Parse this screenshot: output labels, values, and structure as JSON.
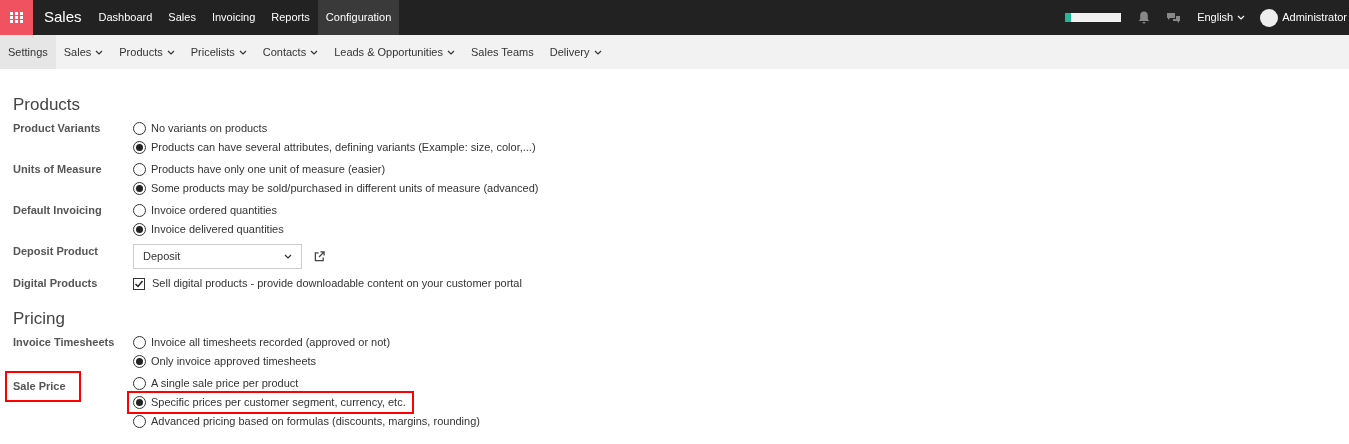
{
  "topbar": {
    "app": "Sales",
    "menu": [
      {
        "label": "Dashboard",
        "selected": false
      },
      {
        "label": "Sales",
        "selected": false
      },
      {
        "label": "Invoicing",
        "selected": false
      },
      {
        "label": "Reports",
        "selected": false
      },
      {
        "label": "Configuration",
        "selected": true
      }
    ],
    "progress": {
      "level": 0.1
    },
    "language": "English",
    "user": "Administrator"
  },
  "submenu": [
    {
      "label": "Settings",
      "selected": true,
      "dropdown": false
    },
    {
      "label": "Sales",
      "selected": false,
      "dropdown": true
    },
    {
      "label": "Products",
      "selected": false,
      "dropdown": true
    },
    {
      "label": "Pricelists",
      "selected": false,
      "dropdown": true
    },
    {
      "label": "Contacts",
      "selected": false,
      "dropdown": true
    },
    {
      "label": "Leads & Opportunities",
      "selected": false,
      "dropdown": true
    },
    {
      "label": "Sales Teams",
      "selected": false,
      "dropdown": false
    },
    {
      "label": "Delivery",
      "selected": false,
      "dropdown": true
    }
  ],
  "sections": [
    {
      "title": "Products",
      "settings": [
        {
          "label": "Product Variants",
          "kind": "radio",
          "highlighted": false,
          "options": [
            {
              "label": "No variants on products",
              "selected": false,
              "highlighted": false
            },
            {
              "label": "Products can have several attributes, defining variants (Example: size, color,...)",
              "selected": true,
              "highlighted": false
            }
          ]
        },
        {
          "label": "Units of Measure",
          "kind": "radio",
          "highlighted": false,
          "options": [
            {
              "label": "Products have only one unit of measure (easier)",
              "selected": false,
              "highlighted": false
            },
            {
              "label": "Some products may be sold/purchased in different units of measure (advanced)",
              "selected": true,
              "highlighted": false
            }
          ]
        },
        {
          "label": "Default Invoicing",
          "kind": "radio",
          "highlighted": false,
          "options": [
            {
              "label": "Invoice ordered quantities",
              "selected": false,
              "highlighted": false
            },
            {
              "label": "Invoice delivered quantities",
              "selected": true,
              "highlighted": false
            }
          ]
        },
        {
          "label": "Deposit Product",
          "kind": "select",
          "highlighted": false,
          "value": "Deposit"
        },
        {
          "label": "Digital Products",
          "kind": "checkbox",
          "highlighted": false,
          "checked": true,
          "text": "Sell digital products - provide downloadable content on your customer portal"
        }
      ]
    },
    {
      "title": "Pricing",
      "settings": [
        {
          "label": "Invoice Timesheets",
          "kind": "radio",
          "highlighted": false,
          "options": [
            {
              "label": "Invoice all timesheets recorded (approved or not)",
              "selected": false,
              "highlighted": false
            },
            {
              "label": "Only invoice approved timesheets",
              "selected": true,
              "highlighted": false
            }
          ]
        },
        {
          "label": "Sale Price",
          "kind": "radio",
          "highlighted": true,
          "options": [
            {
              "label": "A single sale price per product",
              "selected": false,
              "highlighted": false
            },
            {
              "label": "Specific prices per customer segment, currency, etc.",
              "selected": true,
              "highlighted": true
            },
            {
              "label": "Advanced pricing based on formulas (discounts, margins, rounding)",
              "selected": false,
              "highlighted": false
            }
          ]
        }
      ]
    }
  ]
}
